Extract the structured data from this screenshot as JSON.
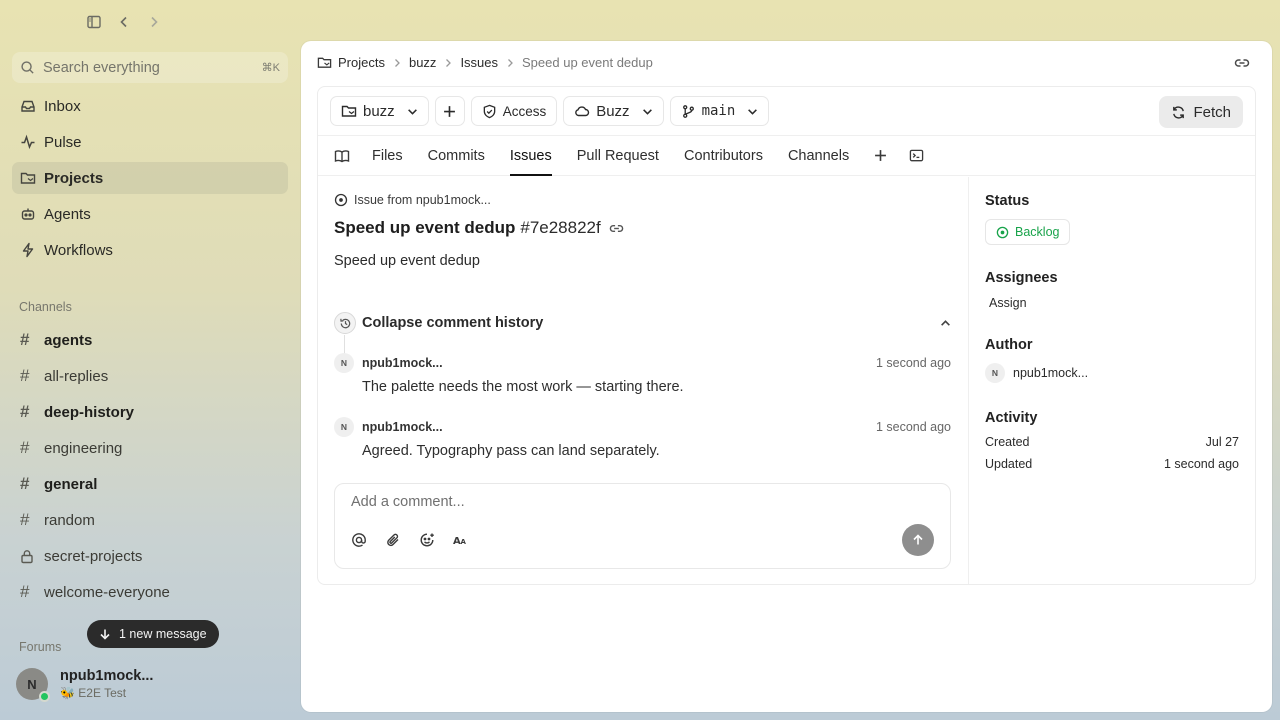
{
  "sidebar": {
    "search": {
      "placeholder": "Search everything",
      "shortcut": "⌘K"
    },
    "nav": [
      {
        "label": "Inbox",
        "icon": "inbox-icon",
        "active": false
      },
      {
        "label": "Pulse",
        "icon": "pulse-icon",
        "active": false
      },
      {
        "label": "Projects",
        "icon": "projects-icon",
        "active": true
      },
      {
        "label": "Agents",
        "icon": "agents-icon",
        "active": false
      },
      {
        "label": "Workflows",
        "icon": "workflows-icon",
        "active": false
      }
    ],
    "channels_label": "Channels",
    "channels": [
      {
        "label": "agents",
        "bold": true,
        "icon": "hash"
      },
      {
        "label": "all-replies",
        "bold": false,
        "icon": "hash"
      },
      {
        "label": "deep-history",
        "bold": true,
        "icon": "hash"
      },
      {
        "label": "engineering",
        "bold": false,
        "icon": "hash"
      },
      {
        "label": "general",
        "bold": true,
        "icon": "hash"
      },
      {
        "label": "random",
        "bold": false,
        "icon": "hash"
      },
      {
        "label": "secret-projects",
        "bold": false,
        "icon": "lock"
      },
      {
        "label": "welcome-everyone",
        "bold": false,
        "icon": "hash"
      }
    ],
    "forums_label": "Forums",
    "new_message": "1 new message",
    "user": {
      "initial": "N",
      "name": "npub1mock...",
      "status": "🐝 E2E Test",
      "online_color": "#22c55e"
    }
  },
  "breadcrumb": {
    "projects": "Projects",
    "repo": "buzz",
    "issues": "Issues",
    "current": "Speed up event dedup"
  },
  "toolbar": {
    "repo": "buzz",
    "access": "Access",
    "cloud": "Buzz",
    "branch": "main",
    "fetch": "Fetch"
  },
  "tabs": [
    "Files",
    "Commits",
    "Issues",
    "Pull Request",
    "Contributors",
    "Channels"
  ],
  "active_tab": "Issues",
  "issue": {
    "from": "Issue from npub1mock...",
    "title": "Speed up event dedup",
    "id": "#7e28822f",
    "body": "Speed up event dedup",
    "collapse_label": "Collapse comment history",
    "comments": [
      {
        "initial": "N",
        "author": "npub1mock...",
        "time": "1 second ago",
        "text": "The palette needs the most work — starting there."
      },
      {
        "initial": "N",
        "author": "npub1mock...",
        "time": "1 second ago",
        "text": "Agreed. Typography pass can land separately."
      }
    ],
    "composer_placeholder": "Add a comment..."
  },
  "details": {
    "status_label": "Status",
    "status_value": "Backlog",
    "status_color": "#18a34a",
    "assignees_label": "Assignees",
    "assign": "Assign",
    "author_label": "Author",
    "author_initial": "N",
    "author_name": "npub1mock...",
    "activity_label": "Activity",
    "created_label": "Created",
    "created_value": "Jul 27",
    "updated_label": "Updated",
    "updated_value": "1 second ago"
  }
}
